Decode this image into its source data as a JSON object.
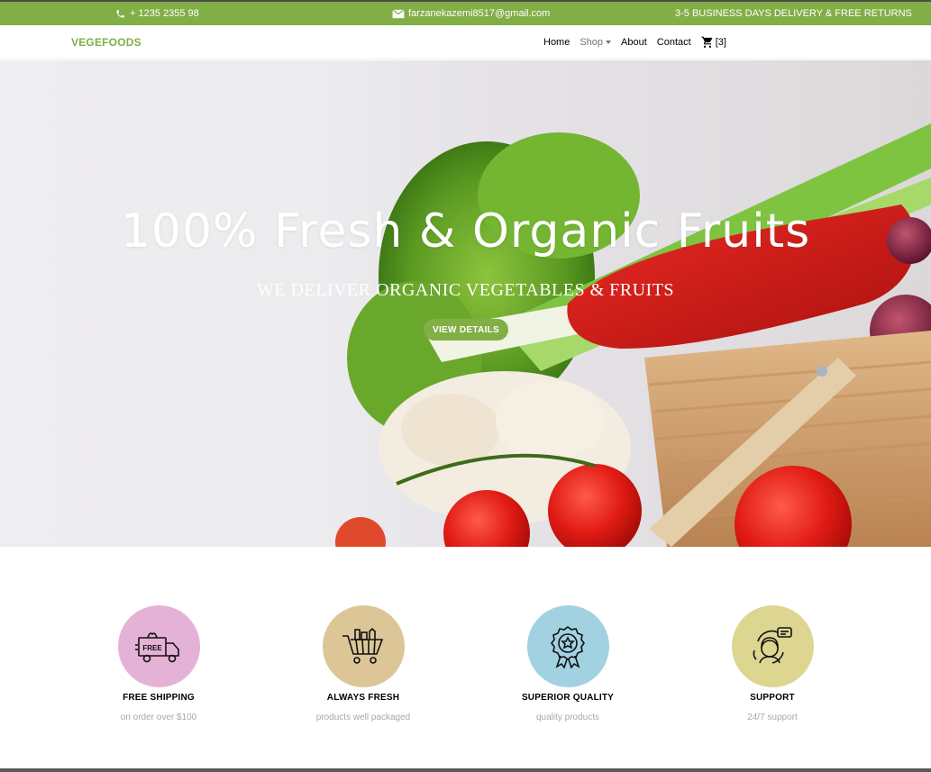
{
  "topbar": {
    "phone": "+ 1235 2355 98",
    "email": "farzanekazemi8517@gmail.com",
    "delivery": "3-5 BUSINESS DAYS DELIVERY & FREE RETURNS"
  },
  "navbar": {
    "brand": "VEGEFOODS",
    "links": {
      "home": "Home",
      "shop": "Shop",
      "about": "About",
      "contact": "Contact"
    },
    "cart_count": "[3]"
  },
  "hero": {
    "title": "100% Fresh & Organic Fruits",
    "subtitle": "WE DELIVER ORGANIC VEGETABLES & FRUITS",
    "button": "VIEW DETAILS"
  },
  "features": [
    {
      "title": "FREE SHIPPING",
      "subtitle": "on order over $100",
      "icon": "free-delivery-truck-icon",
      "color": "#e4b2d6",
      "badge": "FREE"
    },
    {
      "title": "ALWAYS FRESH",
      "subtitle": "products well packaged",
      "icon": "grocery-cart-icon",
      "color": "#dcc698"
    },
    {
      "title": "SUPERIOR QUALITY",
      "subtitle": "quality products",
      "icon": "award-ribbon-icon",
      "color": "#a2d1e1"
    },
    {
      "title": "SUPPORT",
      "subtitle": "24/7 support",
      "icon": "customer-support-icon",
      "color": "#dcd691"
    }
  ],
  "colors": {
    "accent": "#82ae46",
    "topbar_border": "#4b4b4b"
  }
}
